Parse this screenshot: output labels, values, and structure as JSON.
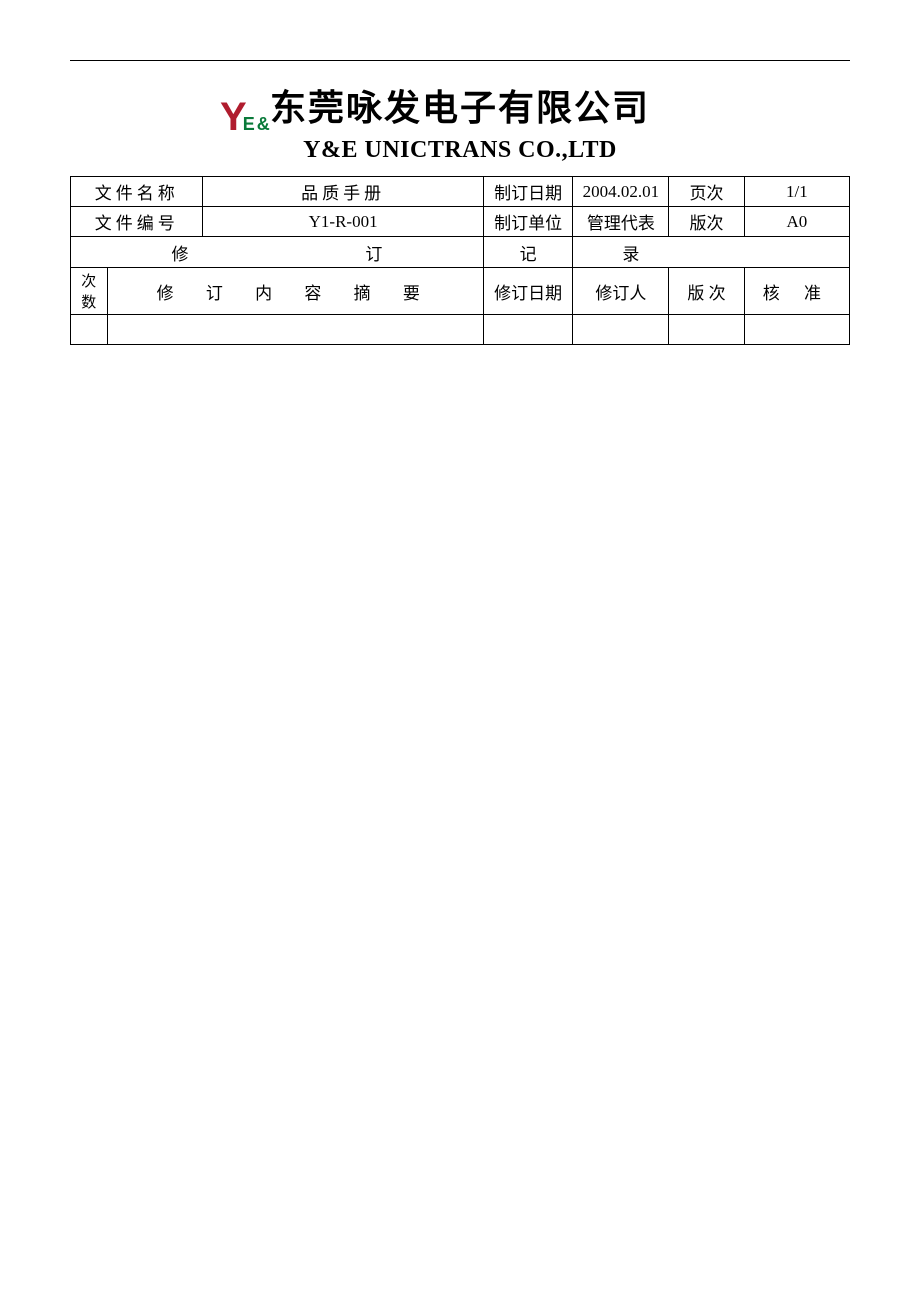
{
  "header": {
    "company_cn": "东莞咏发电子有限公司",
    "company_en": "Y&E UNICTRANS CO.,LTD",
    "logo": {
      "y": "Y",
      "e": "E",
      "amp": "&"
    }
  },
  "meta": {
    "labels": {
      "doc_name": "文件名称",
      "doc_number": "文件编号",
      "issue_date": "制订日期",
      "issue_unit": "制订单位",
      "page": "页次",
      "version": "版次"
    },
    "values": {
      "doc_name": "品质手册",
      "doc_number": "Y1-R-001",
      "issue_date": "2004.02.01",
      "issue_unit": "管理代表",
      "page": "1/1",
      "version": "A0"
    }
  },
  "revision": {
    "section_title_chars": {
      "a": "修",
      "b": "订",
      "c": "记",
      "d": "录"
    },
    "headers": {
      "seq": "次数",
      "summary": "修  订  内  容  摘  要",
      "rev_date": "修订日期",
      "rev_person": "修订人",
      "version": "版 次",
      "approve": "核  准"
    },
    "rows": []
  }
}
